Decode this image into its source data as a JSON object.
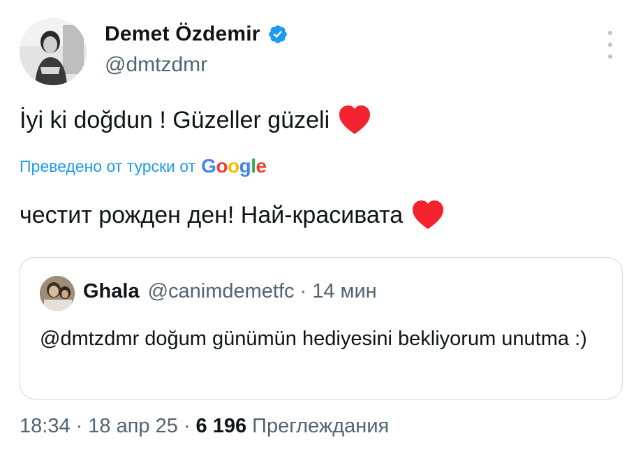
{
  "author": {
    "name": "Demet Özdemir",
    "handle": "@dmtzdmr",
    "avatar_icon": "profile-photo-icon",
    "verified_color": "#1d9bf0"
  },
  "tweet": {
    "text": "İyi ki doğdun ! Güzeller güzeli",
    "translated_label": "Преведено от турски от",
    "translation_provider": "Google",
    "translation": "честит рожден ден! Най-красивата",
    "emoji": "red-heart-icon",
    "heart_color": "#f4212e"
  },
  "quote": {
    "name": "Ghala",
    "handle": "@canimdemetfc",
    "separator": "·",
    "time": "14 мин",
    "text": "@dmtzdmr doğum günümün hediyesini bekliyorum unutma :)"
  },
  "meta": {
    "time": "18:34",
    "sep1": "·",
    "date": "18 апр 25",
    "sep2": "·",
    "views_count": "6 196",
    "views_label": "Преглеждания"
  },
  "colors": {
    "text_primary": "#0f1419",
    "text_secondary": "#536471",
    "accent": "#1d9bf0",
    "border": "#cfd9de"
  }
}
